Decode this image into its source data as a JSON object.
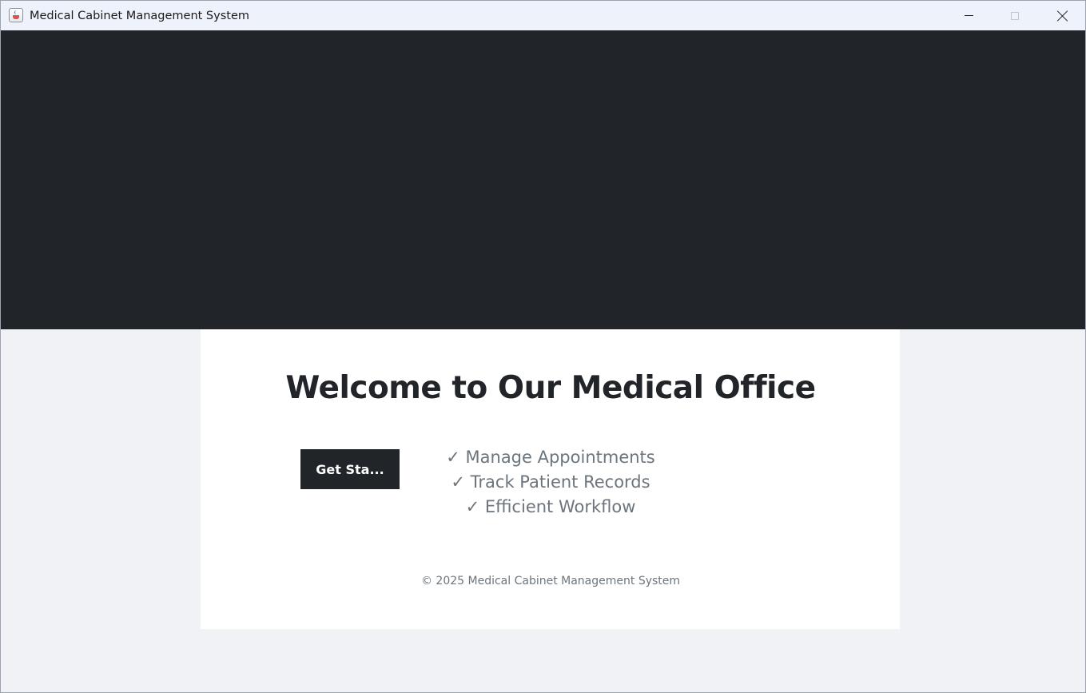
{
  "window": {
    "title": "Medical Cabinet Management System",
    "icon": "java-cup-icon",
    "controls": {
      "minimize_icon": "minimize-icon",
      "maximize_icon": "maximize-icon",
      "close_icon": "close-icon"
    }
  },
  "colors": {
    "hero_background": "#212429",
    "page_background": "#f0f2f5",
    "card_background": "#ffffff",
    "primary_text": "#212429",
    "muted_text": "#6c757d"
  },
  "main": {
    "heading": "Welcome to Our Medical Office",
    "cta_button": "Get Sta...",
    "features": [
      "✓ Manage Appointments",
      "✓ Track Patient Records",
      "✓ Efficient Workflow"
    ],
    "footer": "© 2025 Medical Cabinet Management System"
  }
}
